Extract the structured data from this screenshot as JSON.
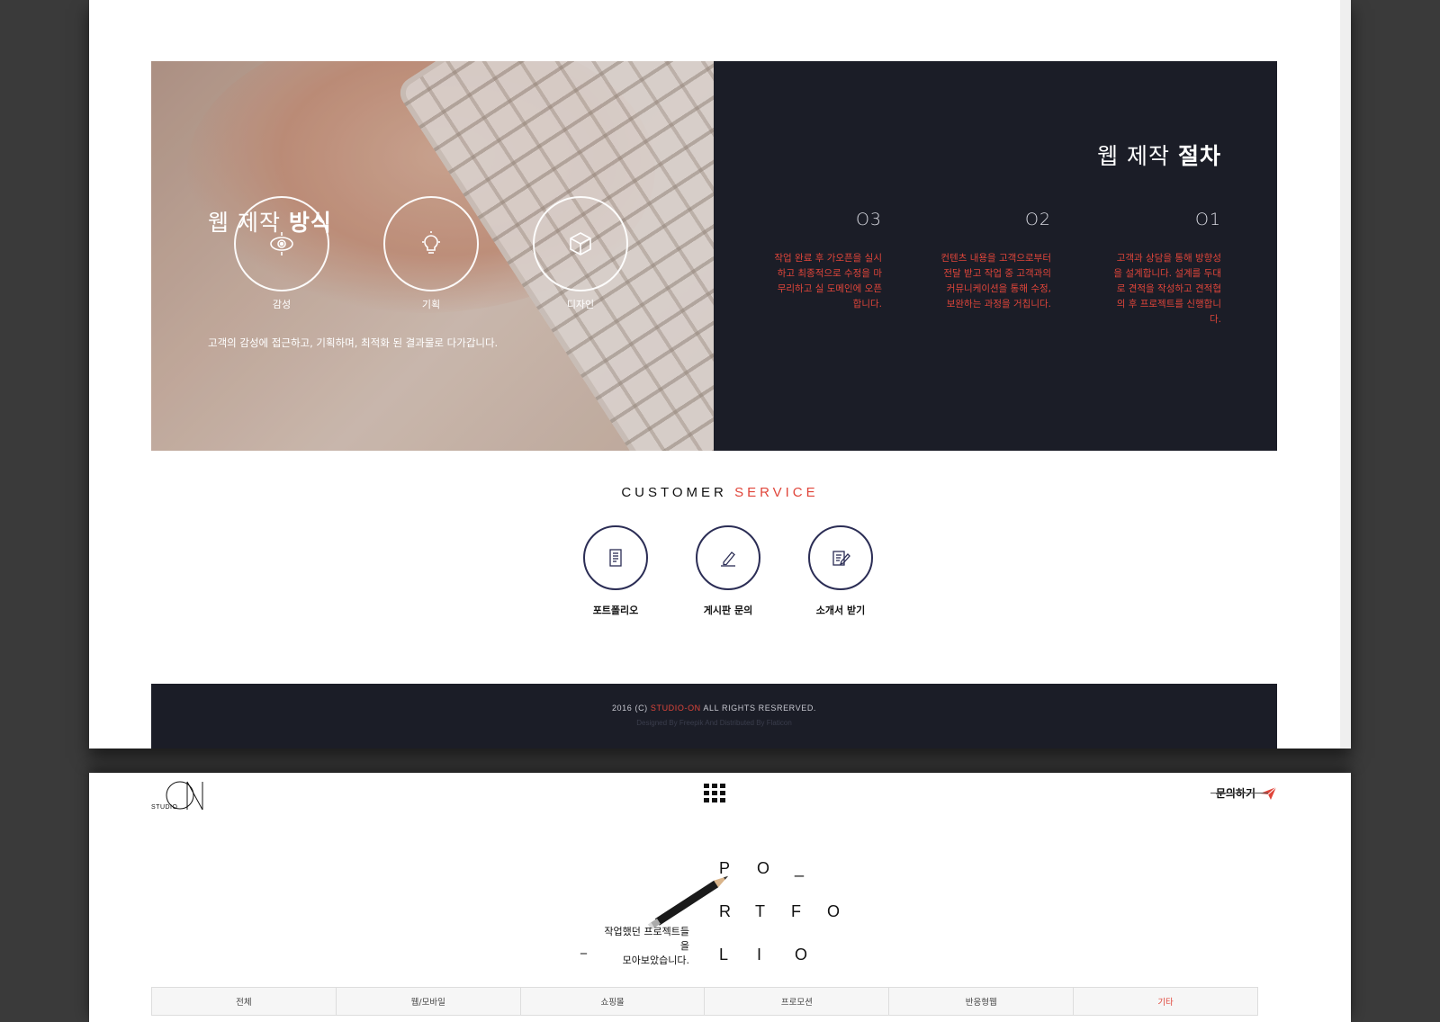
{
  "hero": {
    "left_title_light": "웹 제작 ",
    "left_title_bold": "방식",
    "methods": [
      {
        "label": "감성",
        "icon": "target-eye-icon"
      },
      {
        "label": "기획",
        "icon": "lightbulb-icon"
      },
      {
        "label": "디자인",
        "icon": "cube-icon"
      }
    ],
    "left_description": "고객의 감성에 접근하고, 기획하며, 최적화 된 결과물로 다가갑니다.",
    "right_title_light": "웹 제작 ",
    "right_title_bold": "절차",
    "steps": [
      {
        "number": "O3",
        "text": "작업 완료 후 가오픈을 실시하고 최종적으로 수정을 마무리하고 실 도메인에 오픈합니다."
      },
      {
        "number": "O2",
        "text": "컨텐츠 내용을 고객으로부터 전달 받고 작업 중 고객과의 커뮤니케이션을 통해 수정, 보완하는 과정을 거칩니다."
      },
      {
        "number": "O1",
        "text": "고객과 상담을 통해 방향성을 설계합니다. 설계를 두대로 견적을 작성하고 견적협의 후 프로젝트를 신행합니다."
      }
    ]
  },
  "customer_service": {
    "title_main": "CUSTOMER ",
    "title_accent": "SERVICE",
    "items": [
      {
        "label": "포트폴리오",
        "icon": "document-list-icon"
      },
      {
        "label": "게시판 문의",
        "icon": "pencil-icon"
      },
      {
        "label": "소개서 받기",
        "icon": "edit-document-icon"
      }
    ]
  },
  "footer": {
    "copy_prefix": "2016 (C) ",
    "copy_brand": "STUDIO-ON",
    "copy_suffix": " ALL RIGHTS RESRERVED.",
    "credit": "Designed By Freepik And Distributed By Flaticon"
  },
  "header": {
    "logo_small": "STUDIO",
    "contact_label": "문의하기"
  },
  "portfolio": {
    "description_line1": "작업했던 프로젝트들을",
    "description_line2": "모아보았습니다.",
    "dash": "_",
    "rows": [
      [
        "P",
        "O",
        "_"
      ],
      [
        "R",
        "T",
        "F",
        "O"
      ],
      [
        "L",
        "I",
        "O"
      ]
    ]
  },
  "tabs": [
    {
      "label": "전체",
      "active": false
    },
    {
      "label": "웹/모바일",
      "active": false
    },
    {
      "label": "쇼핑몰",
      "active": false
    },
    {
      "label": "프로모션",
      "active": false
    },
    {
      "label": "반응형웹",
      "active": false
    },
    {
      "label": "기타",
      "active": true
    }
  ],
  "colors": {
    "accent": "#e0453a",
    "navy": "#1b1d27",
    "ring_navy": "#2b2d55"
  }
}
